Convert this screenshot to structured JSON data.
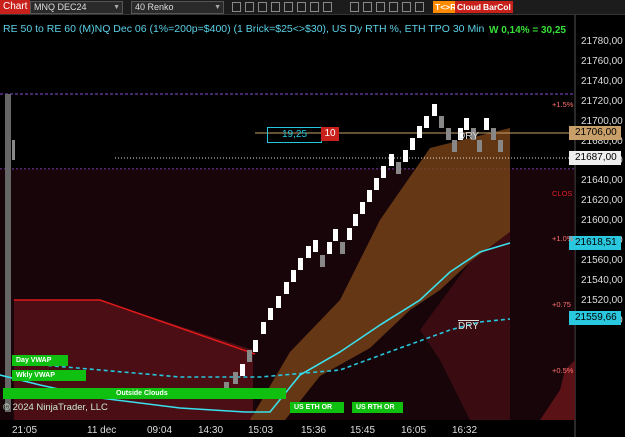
{
  "toolbar": {
    "chart_label": "Chart",
    "instrument": "MNQ DEC24",
    "bar_type": "40 Renko",
    "buttons": [
      {
        "label": "T<>R",
        "color": "#ff8a00"
      },
      {
        "label": "Cloud",
        "color": "#c8201a"
      },
      {
        "label": "BarCol",
        "color": "#c8201a"
      }
    ]
  },
  "header": {
    "subtitle": "RE 50 to RE 60 (M)NQ Dec 06 (1%=200p=$400) (1 Brick=$25<>$30), US Dy RTH %, ETH TPO 30 Min",
    "stat": "W 0,14% = 30,25"
  },
  "price_axis": {
    "ticks": [
      "21780,00",
      "21760,00",
      "21740,00",
      "21720,00",
      "21700,00",
      "21680,00",
      "21660,00",
      "21640,00",
      "21620,00",
      "21600,00",
      "21580,00",
      "21560,00",
      "21540,00",
      "21520,00",
      "21500,00"
    ],
    "current_price": "21706,00",
    "line_price": "21687,00",
    "fast_ma_value": "21618,51",
    "slow_ma_value": "21559,66"
  },
  "time_axis": {
    "labels": [
      "21:05",
      "11 dec",
      "09:04",
      "14:30",
      "15:03",
      "15:36",
      "15:45",
      "16:05",
      "16:32"
    ]
  },
  "indicators": {
    "pct_levels": [
      {
        "label": "+1.5%",
        "color": "#ff7070"
      },
      {
        "label": "CLOS",
        "color": "#e02020"
      },
      {
        "label": "+1.0%",
        "color": "#ff7070"
      },
      {
        "label": "+0.75",
        "color": "#ff7070"
      },
      {
        "label": "+0.5%",
        "color": "#ff7070"
      }
    ],
    "dry_labels": [
      "DRY",
      "DRY"
    ],
    "box_value": "19,25",
    "box_count": "10",
    "buttons": [
      "Day VWAP",
      "Wkly VWAP",
      "Outside Clouds",
      "US ETH OR",
      "US RTH OR"
    ],
    "copyright": "© 2024 NinjaTrader, LLC"
  }
}
